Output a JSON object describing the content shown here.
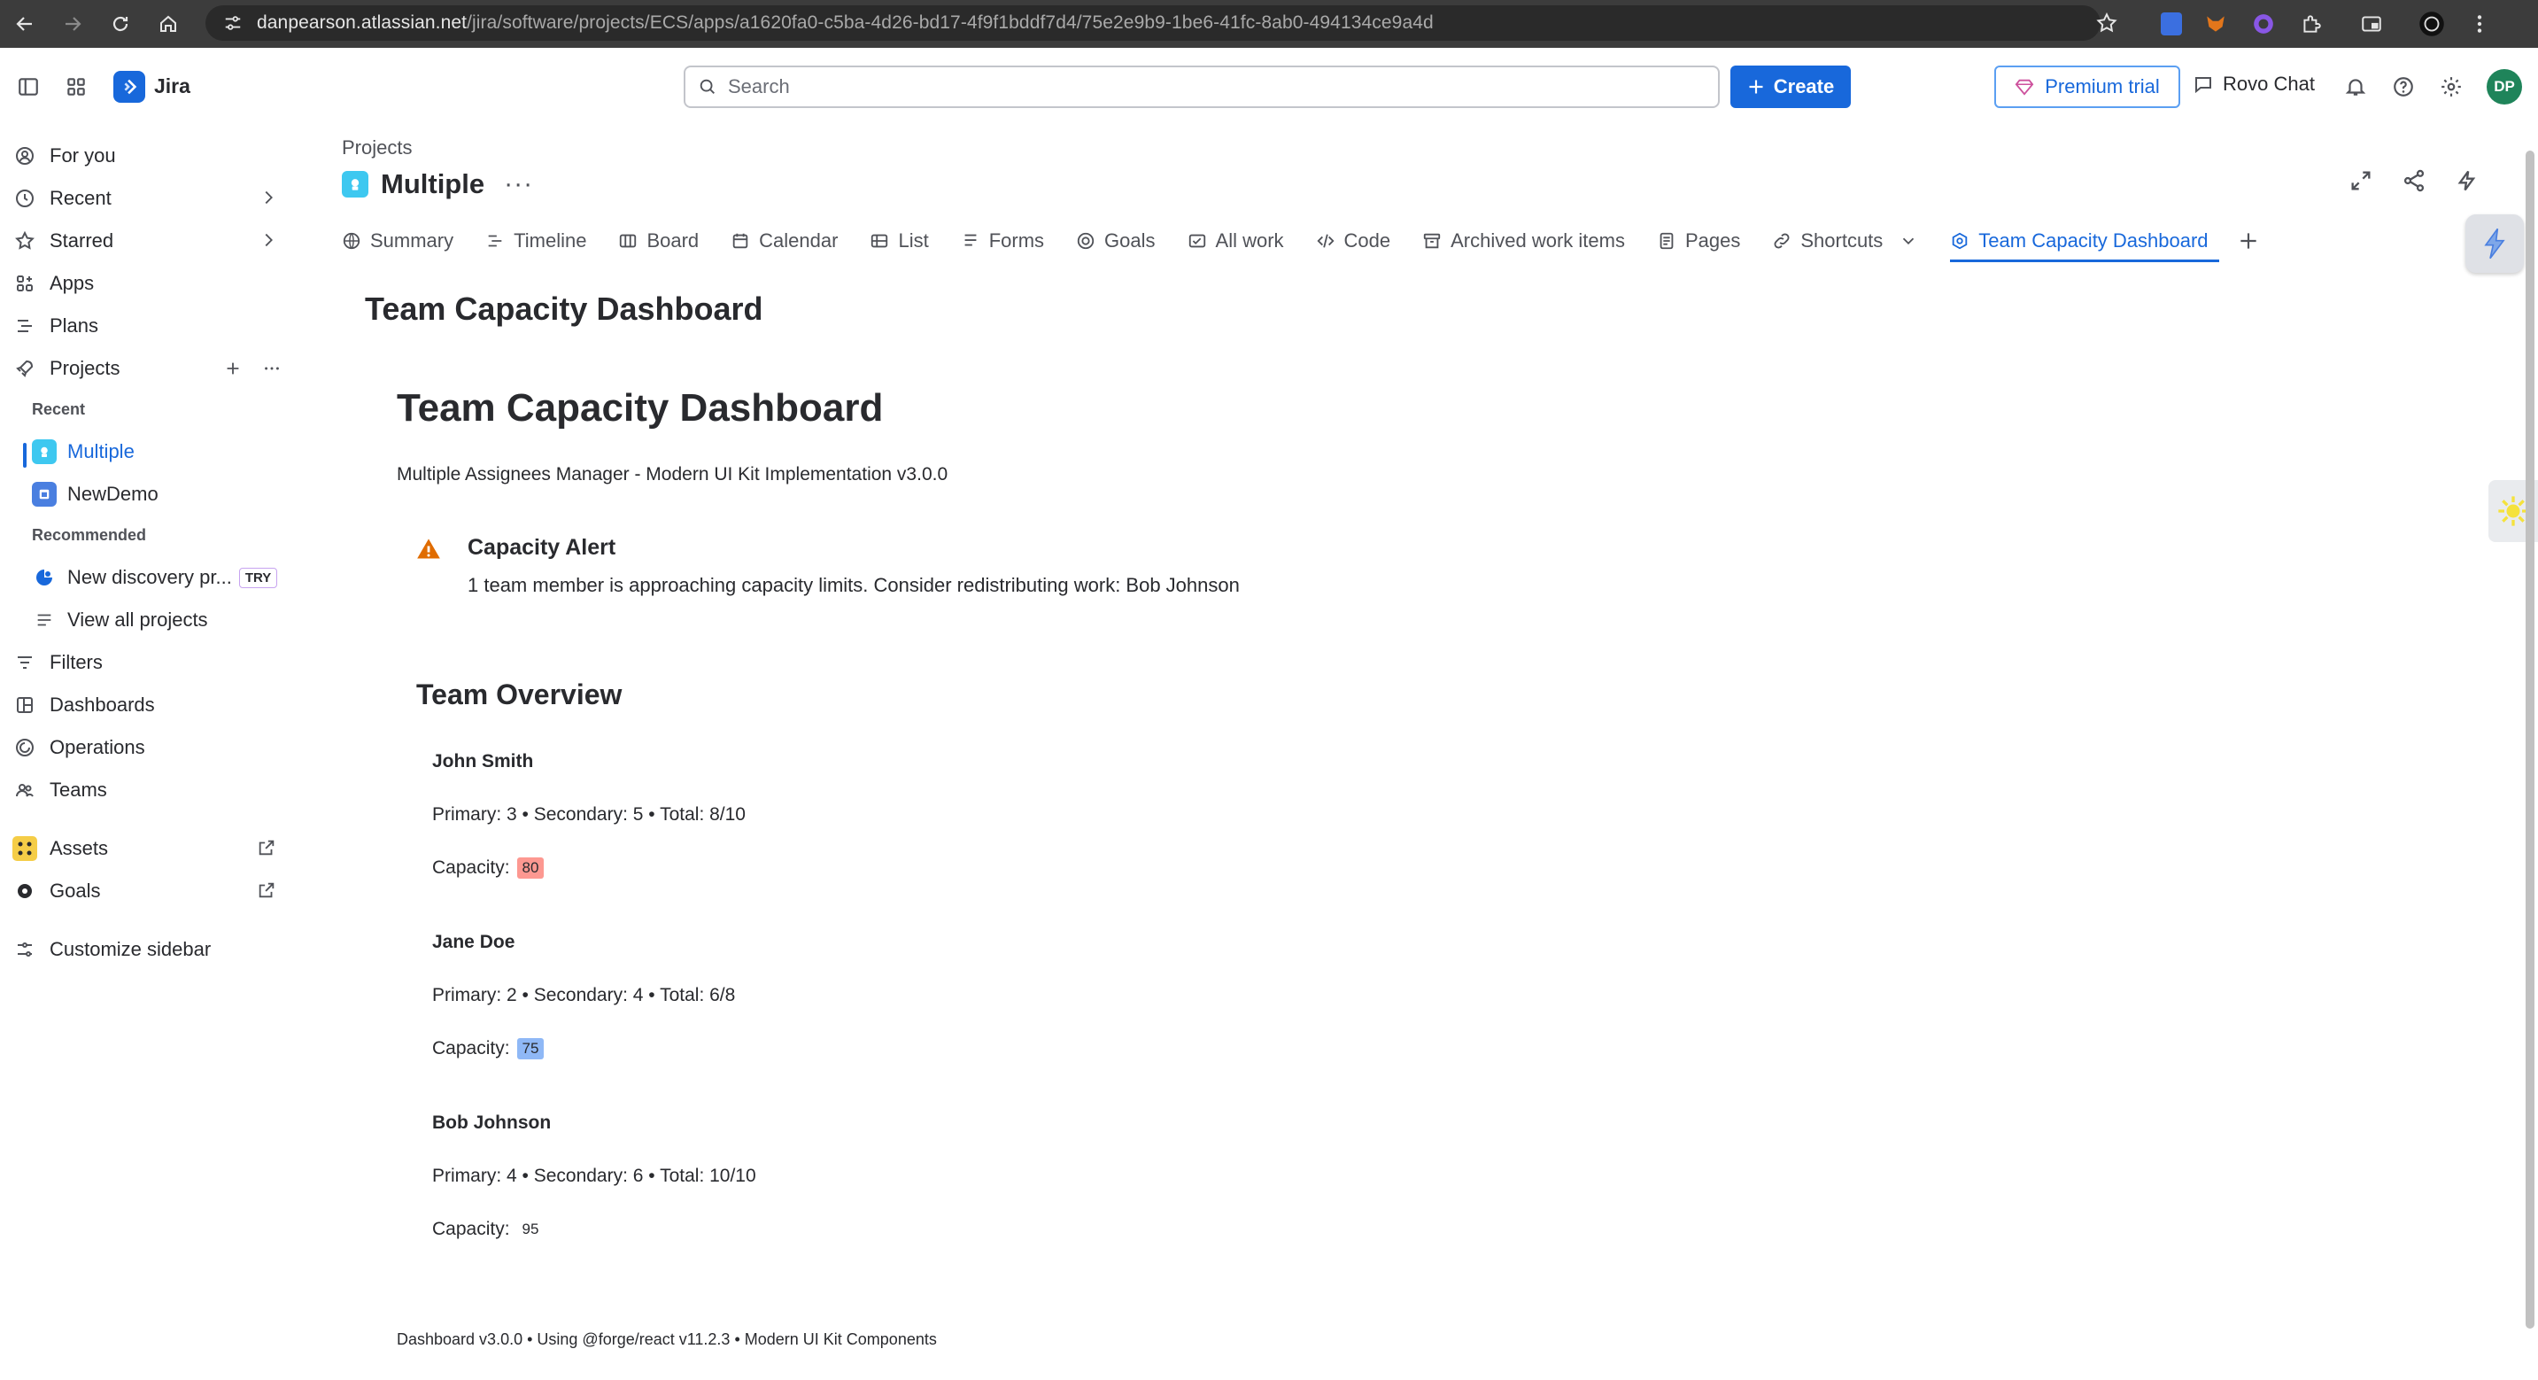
{
  "browser": {
    "url_host": "danpearson.atlassian.net",
    "url_path": "/jira/software/projects/ECS/apps/a1620fa0-c5ba-4d26-bd17-4f9f1bddf7d4/75e2e9b9-1be6-41fc-8ab0-494134ce9a4d"
  },
  "topbar": {
    "app_name": "Jira",
    "search_placeholder": "Search",
    "create_label": "Create",
    "premium_label": "Premium trial",
    "rovo_label": "Rovo Chat",
    "avatar_initials": "DP"
  },
  "sidebar": {
    "items": [
      {
        "label": "For you",
        "icon": "user-circle-icon"
      },
      {
        "label": "Recent",
        "icon": "clock-icon"
      },
      {
        "label": "Starred",
        "icon": "star-icon"
      },
      {
        "label": "Apps",
        "icon": "apps-icon"
      },
      {
        "label": "Plans",
        "icon": "plans-icon"
      },
      {
        "label": "Projects",
        "icon": "rocket-icon"
      }
    ],
    "recent_section": "Recent",
    "recent_projects": [
      {
        "label": "Multiple"
      },
      {
        "label": "NewDemo"
      }
    ],
    "recommended_section": "Recommended",
    "recommended": {
      "label": "New discovery pr...",
      "badge": "TRY"
    },
    "view_all": "View all projects",
    "bottom_items": [
      {
        "label": "Filters",
        "icon": "filter-icon"
      },
      {
        "label": "Dashboards",
        "icon": "dashboard-icon"
      },
      {
        "label": "Operations",
        "icon": "operations-icon"
      },
      {
        "label": "Teams",
        "icon": "teams-icon"
      }
    ],
    "external_items": [
      {
        "label": "Assets",
        "icon": "assets-icon"
      },
      {
        "label": "Goals",
        "icon": "goals-icon"
      }
    ],
    "customize": "Customize sidebar"
  },
  "header": {
    "breadcrumb": "Projects",
    "project_name": "Multiple",
    "more": "···"
  },
  "tabs": [
    {
      "label": "Summary",
      "icon": "globe-icon"
    },
    {
      "label": "Timeline",
      "icon": "timeline-icon"
    },
    {
      "label": "Board",
      "icon": "board-icon"
    },
    {
      "label": "Calendar",
      "icon": "calendar-icon"
    },
    {
      "label": "List",
      "icon": "list-icon"
    },
    {
      "label": "Forms",
      "icon": "forms-icon"
    },
    {
      "label": "Goals",
      "icon": "goal-icon"
    },
    {
      "label": "All work",
      "icon": "all-work-icon"
    },
    {
      "label": "Code",
      "icon": "code-icon"
    },
    {
      "label": "Archived work items",
      "icon": "archive-icon"
    },
    {
      "label": "Pages",
      "icon": "pages-icon"
    },
    {
      "label": "Shortcuts",
      "icon": "link-icon"
    },
    {
      "label": "Team Capacity Dashboard",
      "icon": "app-icon",
      "active": true
    }
  ],
  "app": {
    "title": "Team Capacity Dashboard",
    "dashboard_title": "Team Capacity Dashboard",
    "subtitle": "Multiple Assignees Manager - Modern UI Kit Implementation v3.0.0",
    "alert": {
      "title": "Capacity Alert",
      "message": "1 team member is approaching capacity limits. Consider redistributing work: Bob Johnson"
    },
    "overview_title": "Team Overview",
    "capacity_label": "Capacity:",
    "members": [
      {
        "name": "John Smith",
        "stats": "Primary: 3 • Secondary: 5 • Total: 8/10",
        "capacity": "80",
        "capacity_color": "#fd9891"
      },
      {
        "name": "Jane Doe",
        "stats": "Primary: 2 • Secondary: 4 • Total: 6/8",
        "capacity": "75",
        "capacity_color": "#8fb8f6"
      },
      {
        "name": "Bob Johnson",
        "stats": "Primary: 4 • Secondary: 6 • Total: 10/10",
        "capacity": "95",
        "capacity_color": "#ffffff"
      }
    ],
    "footer": "Dashboard v3.0.0 • Using @forge/react v11.2.3 • Modern UI Kit Components"
  },
  "colors": {
    "accent": "#1868db",
    "alert": "#e06c00"
  }
}
